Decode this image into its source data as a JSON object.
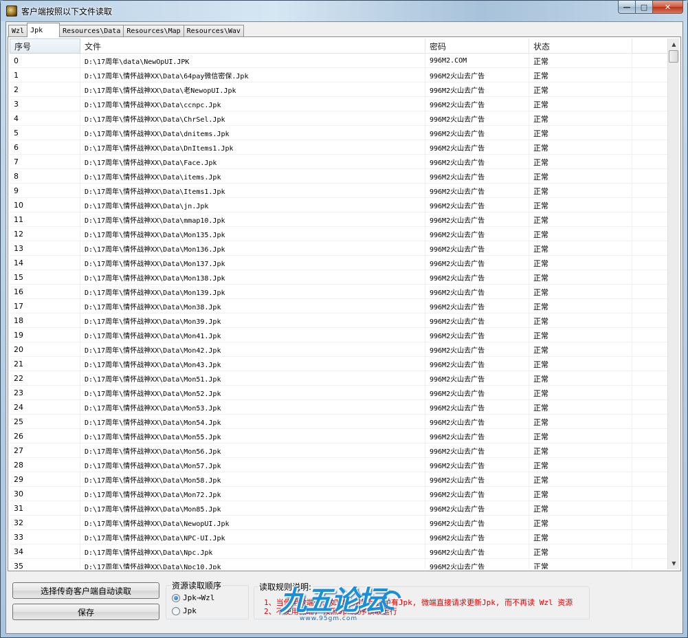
{
  "window": {
    "title": "客户端按照以下文件读取",
    "buttons": {
      "minimize": "—",
      "maximize": "□",
      "close": "✕"
    }
  },
  "tabs": [
    {
      "label": "Wzl",
      "active": false
    },
    {
      "label": "Jpk",
      "active": true
    },
    {
      "label": "Resources\\Data",
      "active": false
    },
    {
      "label": "Resources\\Map",
      "active": false
    },
    {
      "label": "Resources\\Wav",
      "active": false
    }
  ],
  "list": {
    "columns": [
      "序号",
      "文件",
      "密码",
      "状态"
    ],
    "rows": [
      [
        "0",
        "D:\\17周年\\data\\NewOpUI.JPK",
        "996M2.COM",
        "正常"
      ],
      [
        "1",
        "D:\\17周年\\情怀战神XX\\Data\\64pay微信密保.Jpk",
        "996M2火山去广告",
        "正常"
      ],
      [
        "2",
        "D:\\17周年\\情怀战神XX\\Data\\老NewopUI.Jpk",
        "996M2火山去广告",
        "正常"
      ],
      [
        "3",
        "D:\\17周年\\情怀战神XX\\Data\\ccnpc.Jpk",
        "996M2火山去广告",
        "正常"
      ],
      [
        "4",
        "D:\\17周年\\情怀战神XX\\Data\\ChrSel.Jpk",
        "996M2火山去广告",
        "正常"
      ],
      [
        "5",
        "D:\\17周年\\情怀战神XX\\Data\\dnitems.Jpk",
        "996M2火山去广告",
        "正常"
      ],
      [
        "6",
        "D:\\17周年\\情怀战神XX\\Data\\DnItems1.Jpk",
        "996M2火山去广告",
        "正常"
      ],
      [
        "7",
        "D:\\17周年\\情怀战神XX\\Data\\Face.Jpk",
        "996M2火山去广告",
        "正常"
      ],
      [
        "8",
        "D:\\17周年\\情怀战神XX\\Data\\items.Jpk",
        "996M2火山去广告",
        "正常"
      ],
      [
        "9",
        "D:\\17周年\\情怀战神XX\\Data\\Items1.Jpk",
        "996M2火山去广告",
        "正常"
      ],
      [
        "10",
        "D:\\17周年\\情怀战神XX\\Data\\jn.Jpk",
        "996M2火山去广告",
        "正常"
      ],
      [
        "11",
        "D:\\17周年\\情怀战神XX\\Data\\mmap10.Jpk",
        "996M2火山去广告",
        "正常"
      ],
      [
        "12",
        "D:\\17周年\\情怀战神XX\\Data\\Mon135.Jpk",
        "996M2火山去广告",
        "正常"
      ],
      [
        "13",
        "D:\\17周年\\情怀战神XX\\Data\\Mon136.Jpk",
        "996M2火山去广告",
        "正常"
      ],
      [
        "14",
        "D:\\17周年\\情怀战神XX\\Data\\Mon137.Jpk",
        "996M2火山去广告",
        "正常"
      ],
      [
        "15",
        "D:\\17周年\\情怀战神XX\\Data\\Mon138.Jpk",
        "996M2火山去广告",
        "正常"
      ],
      [
        "16",
        "D:\\17周年\\情怀战神XX\\Data\\Mon139.Jpk",
        "996M2火山去广告",
        "正常"
      ],
      [
        "17",
        "D:\\17周年\\情怀战神XX\\Data\\Mon38.Jpk",
        "996M2火山去广告",
        "正常"
      ],
      [
        "18",
        "D:\\17周年\\情怀战神XX\\Data\\Mon39.Jpk",
        "996M2火山去广告",
        "正常"
      ],
      [
        "19",
        "D:\\17周年\\情怀战神XX\\Data\\Mon41.Jpk",
        "996M2火山去广告",
        "正常"
      ],
      [
        "20",
        "D:\\17周年\\情怀战神XX\\Data\\Mon42.Jpk",
        "996M2火山去广告",
        "正常"
      ],
      [
        "21",
        "D:\\17周年\\情怀战神XX\\Data\\Mon43.Jpk",
        "996M2火山去广告",
        "正常"
      ],
      [
        "22",
        "D:\\17周年\\情怀战神XX\\Data\\Mon51.Jpk",
        "996M2火山去广告",
        "正常"
      ],
      [
        "23",
        "D:\\17周年\\情怀战神XX\\Data\\Mon52.Jpk",
        "996M2火山去广告",
        "正常"
      ],
      [
        "24",
        "D:\\17周年\\情怀战神XX\\Data\\Mon53.Jpk",
        "996M2火山去广告",
        "正常"
      ],
      [
        "25",
        "D:\\17周年\\情怀战神XX\\Data\\Mon54.Jpk",
        "996M2火山去广告",
        "正常"
      ],
      [
        "26",
        "D:\\17周年\\情怀战神XX\\Data\\Mon55.Jpk",
        "996M2火山去广告",
        "正常"
      ],
      [
        "27",
        "D:\\17周年\\情怀战神XX\\Data\\Mon56.Jpk",
        "996M2火山去广告",
        "正常"
      ],
      [
        "28",
        "D:\\17周年\\情怀战神XX\\Data\\Mon57.Jpk",
        "996M2火山去广告",
        "正常"
      ],
      [
        "29",
        "D:\\17周年\\情怀战神XX\\Data\\Mon58.Jpk",
        "996M2火山去广告",
        "正常"
      ],
      [
        "30",
        "D:\\17周年\\情怀战神XX\\Data\\Mon72.Jpk",
        "996M2火山去广告",
        "正常"
      ],
      [
        "31",
        "D:\\17周年\\情怀战神XX\\Data\\Mon85.Jpk",
        "996M2火山去广告",
        "正常"
      ],
      [
        "32",
        "D:\\17周年\\情怀战神XX\\Data\\NewopUI.Jpk",
        "996M2火山去广告",
        "正常"
      ],
      [
        "33",
        "D:\\17周年\\情怀战神XX\\Data\\NPC-UI.Jpk",
        "996M2火山去广告",
        "正常"
      ],
      [
        "34",
        "D:\\17周年\\情怀战神XX\\Data\\Npc.Jpk",
        "996M2火山去广告",
        "正常"
      ],
      [
        "35",
        "D:\\17周年\\情怀战神XX\\Data\\Npc10.Jpk",
        "996M2火山去广告",
        "正常"
      ]
    ]
  },
  "actions": {
    "auto_read_label": "选择传奇客户端自动读取",
    "save_label": "保存"
  },
  "read_order": {
    "title": "资源读取顺序",
    "options": [
      {
        "label": "Jpk→Wzl",
        "checked": true
      },
      {
        "label": "Jpk",
        "checked": false
      }
    ]
  },
  "rules": {
    "title": "读取规则说明:",
    "lines": [
      "1、当使用微端时, 如果检测到列表中有Jpk, 微端直接请求更新Jpk, 而不再读 Wzl 资源",
      "2、不使用微端, 按照Jpk顺序读取运行"
    ]
  },
  "watermark": {
    "logo_text": "九五论坛",
    "url": "www.95gm.com"
  }
}
